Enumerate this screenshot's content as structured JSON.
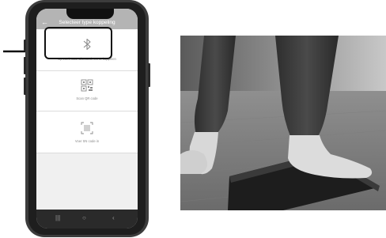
{
  "app": {
    "title": "Selecteer type koppeling",
    "back_icon": "arrow-left-icon"
  },
  "options": [
    {
      "icon": "bluetooth-icon",
      "label": "Op zoek naar Bluetooth om te koppelen"
    },
    {
      "icon": "qr-code-icon",
      "label": "Scan QR code"
    },
    {
      "icon": "sn-code-icon",
      "label": "Voer SN code in"
    }
  ],
  "navbar": {
    "recent_icon": "recent-apps-icon",
    "home_icon": "home-circle-icon",
    "back_icon": "chevron-left-icon"
  },
  "colors": {
    "appbar": "#b4b4b4",
    "highlight": "#111111"
  }
}
